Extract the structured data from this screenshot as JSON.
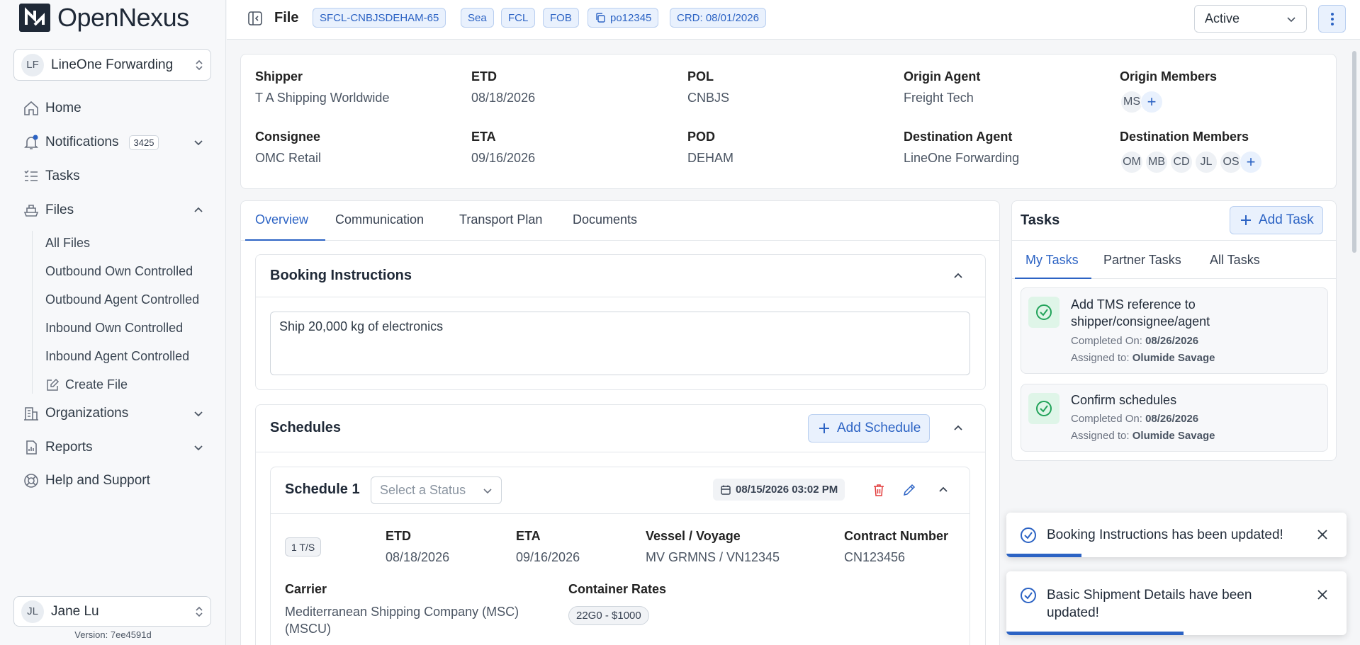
{
  "app": {
    "brand_open": "Open",
    "brand_nexus": "Nexus"
  },
  "sidebar": {
    "org": {
      "initials": "LF",
      "name": "LineOne Forwarding"
    },
    "items": [
      {
        "label": "Home"
      },
      {
        "label": "Notifications",
        "badge": "3425"
      },
      {
        "label": "Tasks"
      },
      {
        "label": "Files"
      },
      {
        "label": "Organizations"
      },
      {
        "label": "Reports"
      },
      {
        "label": "Help and Support"
      }
    ],
    "files_sub": [
      "All Files",
      "Outbound Own Controlled",
      "Outbound Agent Controlled",
      "Inbound Own Controlled",
      "Inbound Agent Controlled",
      "Create File"
    ],
    "user": {
      "initials": "JL",
      "name": "Jane Lu"
    },
    "version": "Version: 7ee4591d"
  },
  "header": {
    "title": "File",
    "tags": [
      "SFCL-CNBJSDEHAM-65",
      "Sea",
      "FCL",
      "FOB",
      "po12345",
      "CRD: 08/01/2026"
    ],
    "status": "Active"
  },
  "details": {
    "shipper_label": "Shipper",
    "shipper": "T A Shipping Worldwide",
    "etd_label": "ETD",
    "etd": "08/18/2026",
    "pol_label": "POL",
    "pol": "CNBJS",
    "origin_agent_label": "Origin Agent",
    "origin_agent": "Freight Tech",
    "origin_members_label": "Origin Members",
    "origin_members": [
      "MS"
    ],
    "consignee_label": "Consignee",
    "consignee": "OMC Retail",
    "eta_label": "ETA",
    "eta": "09/16/2026",
    "pod_label": "POD",
    "pod": "DEHAM",
    "dest_agent_label": "Destination Agent",
    "dest_agent": "LineOne Forwarding",
    "dest_members_label": "Destination Members",
    "dest_members": [
      "OM",
      "MB",
      "CD",
      "JL",
      "OS"
    ]
  },
  "tabs": [
    "Overview",
    "Communication",
    "Transport Plan",
    "Documents"
  ],
  "booking": {
    "title": "Booking Instructions",
    "text": "Ship 20,000 kg of electronics"
  },
  "schedules": {
    "title": "Schedules",
    "add_label": "Add Schedule",
    "schedule": {
      "title": "Schedule 1",
      "status_placeholder": "Select a Status",
      "datetime": "08/15/2026 03:02 PM",
      "ts": "1 T/S",
      "etd_label": "ETD",
      "etd": "08/18/2026",
      "eta_label": "ETA",
      "eta": "09/16/2026",
      "vessel_label": "Vessel / Voyage",
      "vessel": "MV GRMNS / VN12345",
      "contract_label": "Contract Number",
      "contract": "CN123456",
      "carrier_label": "Carrier",
      "carrier": "Mediterranean Shipping Company (MSC) (MSCU)",
      "rates_label": "Container Rates",
      "rate": "22G0 - $1000"
    }
  },
  "tasks": {
    "title": "Tasks",
    "add_label": "Add Task",
    "tabs": [
      "My Tasks",
      "Partner Tasks",
      "All Tasks"
    ],
    "items": [
      {
        "title": "Add TMS reference to shipper/consignee/agent",
        "completed_label": "Completed On:",
        "completed": "08/26/2026",
        "assigned_label": "Assigned to:",
        "assigned": "Olumide Savage"
      },
      {
        "title": "Confirm schedules",
        "completed_label": "Completed On:",
        "completed": "08/26/2026",
        "assigned_label": "Assigned to:",
        "assigned": "Olumide Savage"
      }
    ]
  },
  "toasts": [
    {
      "text": "Booking Instructions has been updated!",
      "progress": 0.22
    },
    {
      "text": "Basic Shipment Details have been updated!",
      "progress": 0.52
    }
  ],
  "colors": {
    "accent": "#2c63c4",
    "success": "#22a35a",
    "danger": "#e23b3b"
  }
}
